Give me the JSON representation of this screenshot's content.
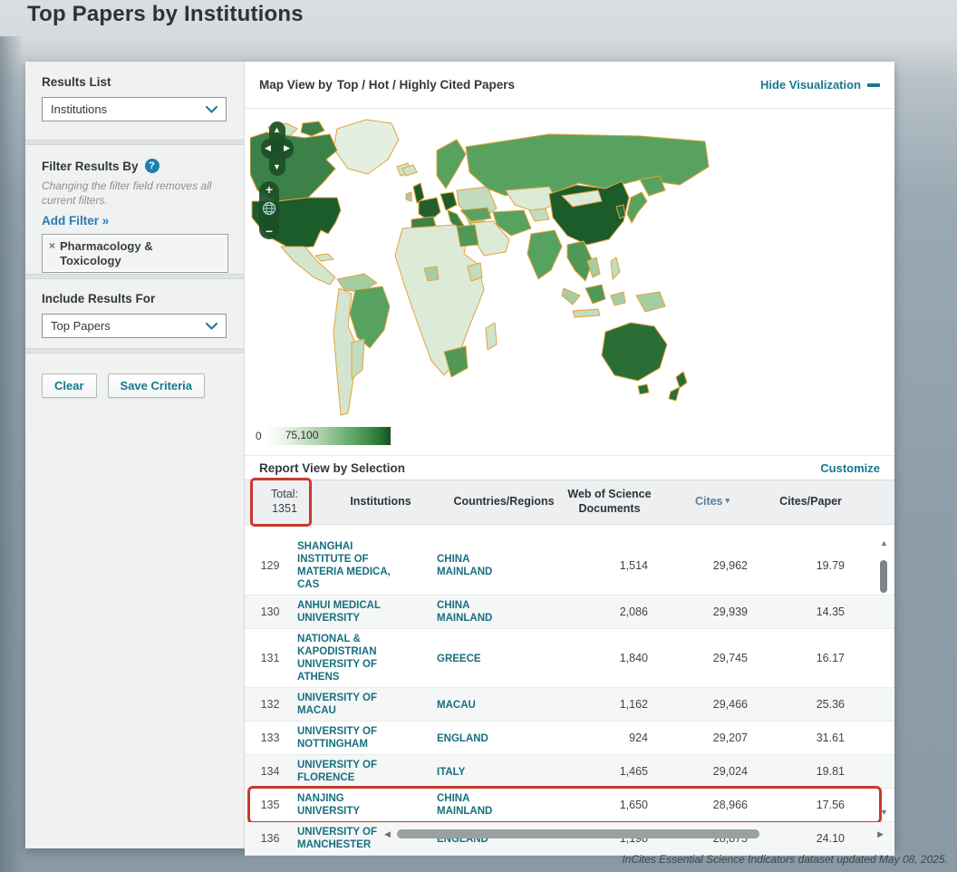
{
  "page": {
    "title": "Top Papers by Institutions",
    "footer": "InCites Essential Science Indicators dataset updated May 08, 2025."
  },
  "sidebar": {
    "results_list": {
      "label": "Results List",
      "value": "Institutions"
    },
    "filter": {
      "label": "Filter Results By",
      "note": "Changing the filter field removes all current filters.",
      "add_filter": "Add Filter »",
      "tag": {
        "remove": "×",
        "label": "Pharmacology & Toxicology"
      }
    },
    "include_results": {
      "label": "Include Results For",
      "value": "Top Papers"
    },
    "buttons": {
      "clear": "Clear",
      "save": "Save Criteria"
    }
  },
  "map_section": {
    "title_prefix": "Map View by",
    "title_value": "Top / Hot / Highly Cited Papers",
    "hide_link": "Hide Visualization",
    "legend": {
      "min": "0",
      "max": "75,100"
    }
  },
  "report": {
    "title": "Report View by Selection",
    "customize": "Customize",
    "total_label": "Total:",
    "total_value": "1351",
    "columns": {
      "institutions": "Institutions",
      "countries": "Countries/Regions",
      "wos_docs": "Web of Science Documents",
      "cites": "Cites",
      "cites_per_paper": "Cites/Paper"
    },
    "rows": [
      {
        "rank": "129",
        "institution": "SHANGHAI INSTITUTE OF MATERIA MEDICA, CAS",
        "country": "CHINA MAINLAND",
        "documents": "1,514",
        "cites": "29,962",
        "cites_per_paper": "19.79",
        "highlighted": false
      },
      {
        "rank": "130",
        "institution": "ANHUI MEDICAL UNIVERSITY",
        "country": "CHINA MAINLAND",
        "documents": "2,086",
        "cites": "29,939",
        "cites_per_paper": "14.35",
        "highlighted": false
      },
      {
        "rank": "131",
        "institution": "NATIONAL & KAPODISTRIAN UNIVERSITY OF ATHENS",
        "country": "GREECE",
        "documents": "1,840",
        "cites": "29,745",
        "cites_per_paper": "16.17",
        "highlighted": false
      },
      {
        "rank": "132",
        "institution": "UNIVERSITY OF MACAU",
        "country": "MACAU",
        "documents": "1,162",
        "cites": "29,466",
        "cites_per_paper": "25.36",
        "highlighted": false
      },
      {
        "rank": "133",
        "institution": "UNIVERSITY OF NOTTINGHAM",
        "country": "ENGLAND",
        "documents": "924",
        "cites": "29,207",
        "cites_per_paper": "31.61",
        "highlighted": false
      },
      {
        "rank": "134",
        "institution": "UNIVERSITY OF FLORENCE",
        "country": "ITALY",
        "documents": "1,465",
        "cites": "29,024",
        "cites_per_paper": "19.81",
        "highlighted": false
      },
      {
        "rank": "135",
        "institution": "NANJING UNIVERSITY",
        "country": "CHINA MAINLAND",
        "documents": "1,650",
        "cites": "28,966",
        "cites_per_paper": "17.56",
        "highlighted": true
      },
      {
        "rank": "136",
        "institution": "UNIVERSITY OF MANCHESTER",
        "country": "ENGLAND",
        "documents": "1,198",
        "cites": "28,875",
        "cites_per_paper": "24.10",
        "highlighted": false
      }
    ]
  },
  "icons": {
    "help": "?",
    "sort_down": "▾",
    "pan_up": "▲",
    "pan_down": "▼",
    "pan_left": "◀",
    "pan_right": "▶",
    "zoom_in": "+",
    "zoom_out": "−",
    "scroll_up": "▲",
    "scroll_down": "▼",
    "scroll_left": "◀",
    "scroll_right": "▶"
  },
  "colors": {
    "accent_teal": "#157890",
    "annotation_red": "#c73b2c",
    "link_blue": "#2a7ab5",
    "map_border": "#e2a43c",
    "map_max_green": "#1c5b2a",
    "map_min_green": "#ffffff"
  }
}
